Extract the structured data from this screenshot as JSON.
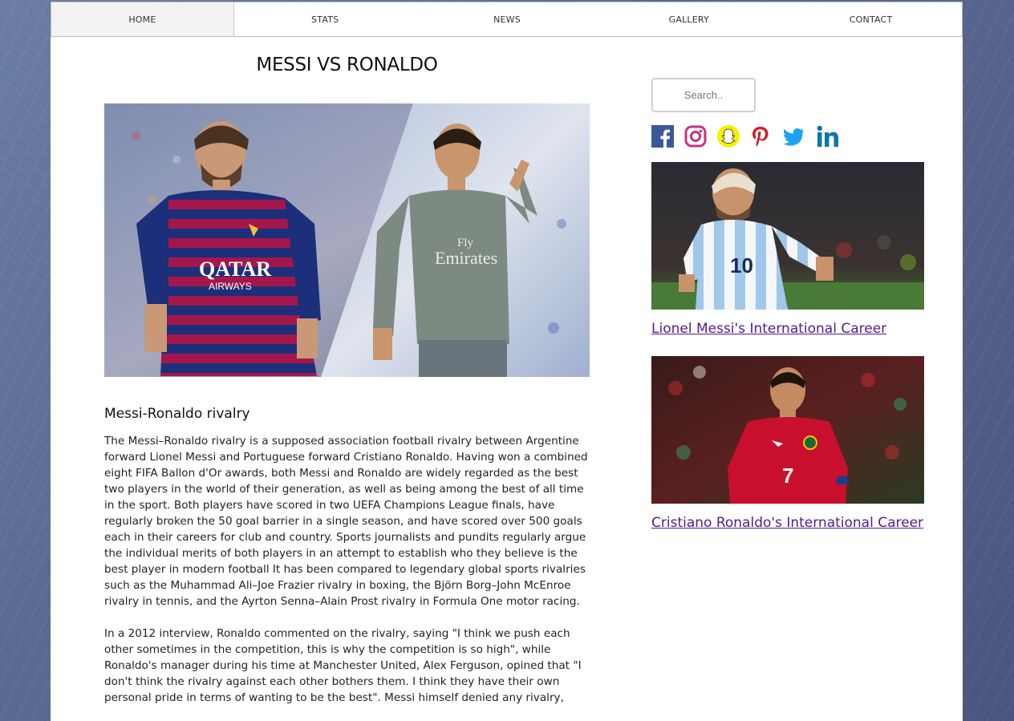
{
  "nav": {
    "items": [
      {
        "label": "HOME",
        "active": true
      },
      {
        "label": "STATS",
        "active": false
      },
      {
        "label": "NEWS",
        "active": false
      },
      {
        "label": "GALLERY",
        "active": false
      },
      {
        "label": "CONTACT",
        "active": false
      }
    ]
  },
  "main": {
    "title": "MESSI VS RONALDO",
    "hero": {
      "left_shirt_text": "QATAR",
      "left_shirt_subtext": "AIRWAYS",
      "right_shirt_text": "Fly",
      "right_shirt_subtext": "Emirates"
    },
    "section_heading": "Messi-Ronaldo rivalry",
    "paragraphs": [
      "The Messi–Ronaldo rivalry is a supposed association football rivalry between Argentine forward Lionel Messi and Portuguese forward Cristiano Ronaldo. Having won a combined eight FIFA Ballon d'Or awards, both Messi and Ronaldo are widely regarded as the best two players in the world of their generation, as well as being among the best of all time in the sport. Both players have scored in two UEFA Champions League finals, have regularly broken the 50 goal barrier in a single season, and have scored over 500 goals each in their careers for club and country. Sports journalists and pundits regularly argue the individual merits of both players in an attempt to establish who they believe is the best player in modern football It has been compared to legendary global sports rivalries such as the Muhammad Ali–Joe Frazier rivalry in boxing, the Björn Borg–John McEnroe rivalry in tennis, and the Ayrton Senna–Alain Prost rivalry in Formula One motor racing.",
      "In a 2012 interview, Ronaldo commented on the rivalry, saying \"I think we push each other sometimes in the competition, this is why the competition is so high\", while Ronaldo's manager during his time at Manchester United, Alex Ferguson, opined that \"I don't think the rivalry against each other bothers them. I think they have their own personal pride in terms of wanting to be the best\". Messi himself denied any rivalry,"
    ]
  },
  "sidebar": {
    "search_placeholder": "Search..",
    "social": [
      {
        "icon": "facebook-icon",
        "color": "#3b5998"
      },
      {
        "icon": "instagram-icon",
        "color": "#c13584"
      },
      {
        "icon": "snapchat-icon",
        "color": "#f7f000"
      },
      {
        "icon": "pinterest-icon",
        "color": "#cb2027"
      },
      {
        "icon": "twitter-icon",
        "color": "#1da1f2"
      },
      {
        "icon": "linkedin-icon",
        "color": "#0e76a8"
      }
    ],
    "cards": [
      {
        "link": "Lionel Messi's International Career",
        "shirt_number": "10"
      },
      {
        "link": "Cristiano Ronaldo's International Career",
        "shirt_number": "7"
      }
    ]
  },
  "colors": {
    "link": "#551a8b",
    "nav_active_bg": "#f2f2f2",
    "page_bg": "#ffffff"
  }
}
